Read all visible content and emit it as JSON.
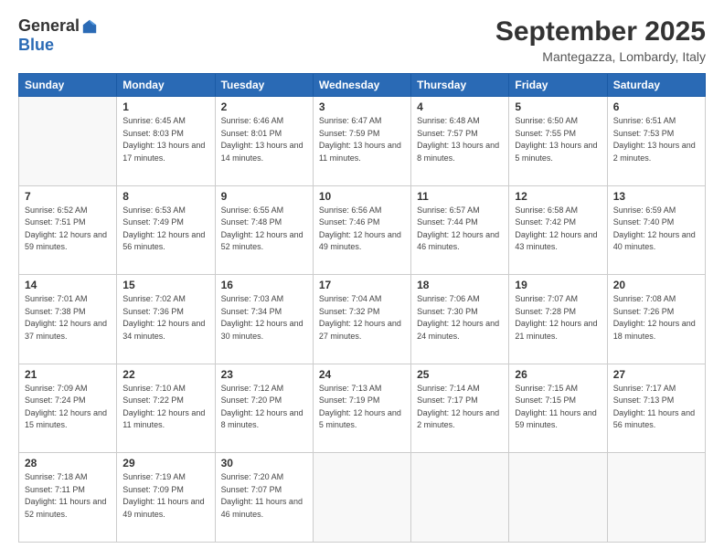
{
  "logo": {
    "general": "General",
    "blue": "Blue"
  },
  "title": "September 2025",
  "location": "Mantegazza, Lombardy, Italy",
  "headers": [
    "Sunday",
    "Monday",
    "Tuesday",
    "Wednesday",
    "Thursday",
    "Friday",
    "Saturday"
  ],
  "weeks": [
    [
      {
        "day": "",
        "sunrise": "",
        "sunset": "",
        "daylight": ""
      },
      {
        "day": "1",
        "sunrise": "Sunrise: 6:45 AM",
        "sunset": "Sunset: 8:03 PM",
        "daylight": "Daylight: 13 hours and 17 minutes."
      },
      {
        "day": "2",
        "sunrise": "Sunrise: 6:46 AM",
        "sunset": "Sunset: 8:01 PM",
        "daylight": "Daylight: 13 hours and 14 minutes."
      },
      {
        "day": "3",
        "sunrise": "Sunrise: 6:47 AM",
        "sunset": "Sunset: 7:59 PM",
        "daylight": "Daylight: 13 hours and 11 minutes."
      },
      {
        "day": "4",
        "sunrise": "Sunrise: 6:48 AM",
        "sunset": "Sunset: 7:57 PM",
        "daylight": "Daylight: 13 hours and 8 minutes."
      },
      {
        "day": "5",
        "sunrise": "Sunrise: 6:50 AM",
        "sunset": "Sunset: 7:55 PM",
        "daylight": "Daylight: 13 hours and 5 minutes."
      },
      {
        "day": "6",
        "sunrise": "Sunrise: 6:51 AM",
        "sunset": "Sunset: 7:53 PM",
        "daylight": "Daylight: 13 hours and 2 minutes."
      }
    ],
    [
      {
        "day": "7",
        "sunrise": "Sunrise: 6:52 AM",
        "sunset": "Sunset: 7:51 PM",
        "daylight": "Daylight: 12 hours and 59 minutes."
      },
      {
        "day": "8",
        "sunrise": "Sunrise: 6:53 AM",
        "sunset": "Sunset: 7:49 PM",
        "daylight": "Daylight: 12 hours and 56 minutes."
      },
      {
        "day": "9",
        "sunrise": "Sunrise: 6:55 AM",
        "sunset": "Sunset: 7:48 PM",
        "daylight": "Daylight: 12 hours and 52 minutes."
      },
      {
        "day": "10",
        "sunrise": "Sunrise: 6:56 AM",
        "sunset": "Sunset: 7:46 PM",
        "daylight": "Daylight: 12 hours and 49 minutes."
      },
      {
        "day": "11",
        "sunrise": "Sunrise: 6:57 AM",
        "sunset": "Sunset: 7:44 PM",
        "daylight": "Daylight: 12 hours and 46 minutes."
      },
      {
        "day": "12",
        "sunrise": "Sunrise: 6:58 AM",
        "sunset": "Sunset: 7:42 PM",
        "daylight": "Daylight: 12 hours and 43 minutes."
      },
      {
        "day": "13",
        "sunrise": "Sunrise: 6:59 AM",
        "sunset": "Sunset: 7:40 PM",
        "daylight": "Daylight: 12 hours and 40 minutes."
      }
    ],
    [
      {
        "day": "14",
        "sunrise": "Sunrise: 7:01 AM",
        "sunset": "Sunset: 7:38 PM",
        "daylight": "Daylight: 12 hours and 37 minutes."
      },
      {
        "day": "15",
        "sunrise": "Sunrise: 7:02 AM",
        "sunset": "Sunset: 7:36 PM",
        "daylight": "Daylight: 12 hours and 34 minutes."
      },
      {
        "day": "16",
        "sunrise": "Sunrise: 7:03 AM",
        "sunset": "Sunset: 7:34 PM",
        "daylight": "Daylight: 12 hours and 30 minutes."
      },
      {
        "day": "17",
        "sunrise": "Sunrise: 7:04 AM",
        "sunset": "Sunset: 7:32 PM",
        "daylight": "Daylight: 12 hours and 27 minutes."
      },
      {
        "day": "18",
        "sunrise": "Sunrise: 7:06 AM",
        "sunset": "Sunset: 7:30 PM",
        "daylight": "Daylight: 12 hours and 24 minutes."
      },
      {
        "day": "19",
        "sunrise": "Sunrise: 7:07 AM",
        "sunset": "Sunset: 7:28 PM",
        "daylight": "Daylight: 12 hours and 21 minutes."
      },
      {
        "day": "20",
        "sunrise": "Sunrise: 7:08 AM",
        "sunset": "Sunset: 7:26 PM",
        "daylight": "Daylight: 12 hours and 18 minutes."
      }
    ],
    [
      {
        "day": "21",
        "sunrise": "Sunrise: 7:09 AM",
        "sunset": "Sunset: 7:24 PM",
        "daylight": "Daylight: 12 hours and 15 minutes."
      },
      {
        "day": "22",
        "sunrise": "Sunrise: 7:10 AM",
        "sunset": "Sunset: 7:22 PM",
        "daylight": "Daylight: 12 hours and 11 minutes."
      },
      {
        "day": "23",
        "sunrise": "Sunrise: 7:12 AM",
        "sunset": "Sunset: 7:20 PM",
        "daylight": "Daylight: 12 hours and 8 minutes."
      },
      {
        "day": "24",
        "sunrise": "Sunrise: 7:13 AM",
        "sunset": "Sunset: 7:19 PM",
        "daylight": "Daylight: 12 hours and 5 minutes."
      },
      {
        "day": "25",
        "sunrise": "Sunrise: 7:14 AM",
        "sunset": "Sunset: 7:17 PM",
        "daylight": "Daylight: 12 hours and 2 minutes."
      },
      {
        "day": "26",
        "sunrise": "Sunrise: 7:15 AM",
        "sunset": "Sunset: 7:15 PM",
        "daylight": "Daylight: 11 hours and 59 minutes."
      },
      {
        "day": "27",
        "sunrise": "Sunrise: 7:17 AM",
        "sunset": "Sunset: 7:13 PM",
        "daylight": "Daylight: 11 hours and 56 minutes."
      }
    ],
    [
      {
        "day": "28",
        "sunrise": "Sunrise: 7:18 AM",
        "sunset": "Sunset: 7:11 PM",
        "daylight": "Daylight: 11 hours and 52 minutes."
      },
      {
        "day": "29",
        "sunrise": "Sunrise: 7:19 AM",
        "sunset": "Sunset: 7:09 PM",
        "daylight": "Daylight: 11 hours and 49 minutes."
      },
      {
        "day": "30",
        "sunrise": "Sunrise: 7:20 AM",
        "sunset": "Sunset: 7:07 PM",
        "daylight": "Daylight: 11 hours and 46 minutes."
      },
      {
        "day": "",
        "sunrise": "",
        "sunset": "",
        "daylight": ""
      },
      {
        "day": "",
        "sunrise": "",
        "sunset": "",
        "daylight": ""
      },
      {
        "day": "",
        "sunrise": "",
        "sunset": "",
        "daylight": ""
      },
      {
        "day": "",
        "sunrise": "",
        "sunset": "",
        "daylight": ""
      }
    ]
  ]
}
